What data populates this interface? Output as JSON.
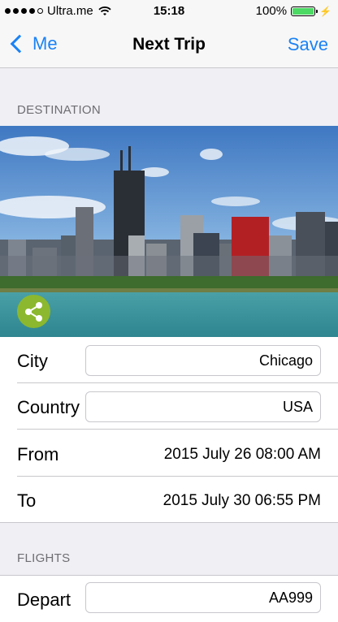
{
  "status_bar": {
    "carrier": "Ultra.me",
    "time": "15:18",
    "battery": "100%"
  },
  "nav": {
    "back_label": "Me",
    "title": "Next Trip",
    "save_label": "Save"
  },
  "destination": {
    "header": "DESTINATION",
    "city_label": "City",
    "city_value": "Chicago",
    "country_label": "Country",
    "country_value": "USA",
    "from_label": "From",
    "from_value": "2015 July 26 08:00 AM",
    "to_label": "To",
    "to_value": "2015 July 30 06:55 PM"
  },
  "flights": {
    "header": "FLIGHTS",
    "depart_label": "Depart",
    "depart_value": "AA999"
  },
  "colors": {
    "accent": "#1a82f5",
    "share": "#8cb82f",
    "battery": "#4cd964"
  }
}
